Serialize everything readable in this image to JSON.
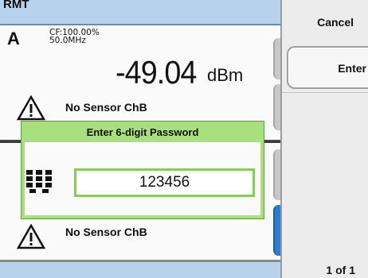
{
  "status_bar": {
    "mode_text": "RMT"
  },
  "window_a": {
    "channel": "A",
    "center_frequency_line": "CF:100.00%",
    "frequency_line": "50.0MHz",
    "reading": "-49.04",
    "unit": "dBm",
    "warning_text": "No Sensor ChB",
    "small_label": "A"
  },
  "window_b": {
    "warning_text": "No Sensor ChB"
  },
  "softkeys": {
    "cancel_label": "Cancel",
    "enter_label": "Enter",
    "page_indicator": "1 of 1"
  },
  "dialog": {
    "title": "Enter 6-digit Password",
    "password_value": "123456"
  },
  "colors": {
    "status_bar": "#b7d3ec",
    "dialog_green": "#a8e07e",
    "field_border": "#86cc5a",
    "active_tab": "#2a7fd0"
  },
  "icons": [
    "warning-triangle-icon",
    "keypad-icon"
  ]
}
